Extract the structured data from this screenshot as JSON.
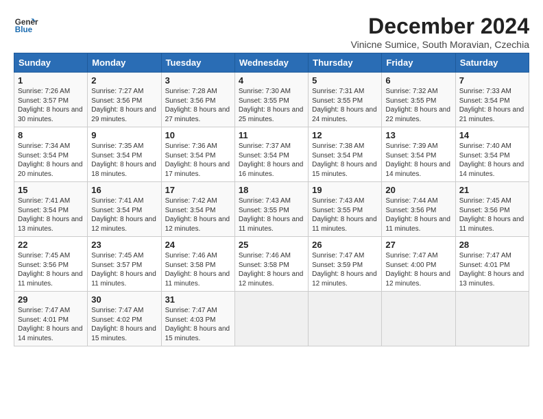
{
  "header": {
    "logo_line1": "General",
    "logo_line2": "Blue",
    "month": "December 2024",
    "location": "Vinicne Sumice, South Moravian, Czechia"
  },
  "weekdays": [
    "Sunday",
    "Monday",
    "Tuesday",
    "Wednesday",
    "Thursday",
    "Friday",
    "Saturday"
  ],
  "weeks": [
    [
      {
        "day": "1",
        "sunrise": "7:26 AM",
        "sunset": "3:57 PM",
        "daylight": "8 hours and 30 minutes."
      },
      {
        "day": "2",
        "sunrise": "7:27 AM",
        "sunset": "3:56 PM",
        "daylight": "8 hours and 29 minutes."
      },
      {
        "day": "3",
        "sunrise": "7:28 AM",
        "sunset": "3:56 PM",
        "daylight": "8 hours and 27 minutes."
      },
      {
        "day": "4",
        "sunrise": "7:30 AM",
        "sunset": "3:55 PM",
        "daylight": "8 hours and 25 minutes."
      },
      {
        "day": "5",
        "sunrise": "7:31 AM",
        "sunset": "3:55 PM",
        "daylight": "8 hours and 24 minutes."
      },
      {
        "day": "6",
        "sunrise": "7:32 AM",
        "sunset": "3:55 PM",
        "daylight": "8 hours and 22 minutes."
      },
      {
        "day": "7",
        "sunrise": "7:33 AM",
        "sunset": "3:54 PM",
        "daylight": "8 hours and 21 minutes."
      }
    ],
    [
      {
        "day": "8",
        "sunrise": "7:34 AM",
        "sunset": "3:54 PM",
        "daylight": "8 hours and 20 minutes."
      },
      {
        "day": "9",
        "sunrise": "7:35 AM",
        "sunset": "3:54 PM",
        "daylight": "8 hours and 18 minutes."
      },
      {
        "day": "10",
        "sunrise": "7:36 AM",
        "sunset": "3:54 PM",
        "daylight": "8 hours and 17 minutes."
      },
      {
        "day": "11",
        "sunrise": "7:37 AM",
        "sunset": "3:54 PM",
        "daylight": "8 hours and 16 minutes."
      },
      {
        "day": "12",
        "sunrise": "7:38 AM",
        "sunset": "3:54 PM",
        "daylight": "8 hours and 15 minutes."
      },
      {
        "day": "13",
        "sunrise": "7:39 AM",
        "sunset": "3:54 PM",
        "daylight": "8 hours and 14 minutes."
      },
      {
        "day": "14",
        "sunrise": "7:40 AM",
        "sunset": "3:54 PM",
        "daylight": "8 hours and 14 minutes."
      }
    ],
    [
      {
        "day": "15",
        "sunrise": "7:41 AM",
        "sunset": "3:54 PM",
        "daylight": "8 hours and 13 minutes."
      },
      {
        "day": "16",
        "sunrise": "7:41 AM",
        "sunset": "3:54 PM",
        "daylight": "8 hours and 12 minutes."
      },
      {
        "day": "17",
        "sunrise": "7:42 AM",
        "sunset": "3:54 PM",
        "daylight": "8 hours and 12 minutes."
      },
      {
        "day": "18",
        "sunrise": "7:43 AM",
        "sunset": "3:55 PM",
        "daylight": "8 hours and 11 minutes."
      },
      {
        "day": "19",
        "sunrise": "7:43 AM",
        "sunset": "3:55 PM",
        "daylight": "8 hours and 11 minutes."
      },
      {
        "day": "20",
        "sunrise": "7:44 AM",
        "sunset": "3:56 PM",
        "daylight": "8 hours and 11 minutes."
      },
      {
        "day": "21",
        "sunrise": "7:45 AM",
        "sunset": "3:56 PM",
        "daylight": "8 hours and 11 minutes."
      }
    ],
    [
      {
        "day": "22",
        "sunrise": "7:45 AM",
        "sunset": "3:56 PM",
        "daylight": "8 hours and 11 minutes."
      },
      {
        "day": "23",
        "sunrise": "7:45 AM",
        "sunset": "3:57 PM",
        "daylight": "8 hours and 11 minutes."
      },
      {
        "day": "24",
        "sunrise": "7:46 AM",
        "sunset": "3:58 PM",
        "daylight": "8 hours and 11 minutes."
      },
      {
        "day": "25",
        "sunrise": "7:46 AM",
        "sunset": "3:58 PM",
        "daylight": "8 hours and 12 minutes."
      },
      {
        "day": "26",
        "sunrise": "7:47 AM",
        "sunset": "3:59 PM",
        "daylight": "8 hours and 12 minutes."
      },
      {
        "day": "27",
        "sunrise": "7:47 AM",
        "sunset": "4:00 PM",
        "daylight": "8 hours and 12 minutes."
      },
      {
        "day": "28",
        "sunrise": "7:47 AM",
        "sunset": "4:01 PM",
        "daylight": "8 hours and 13 minutes."
      }
    ],
    [
      {
        "day": "29",
        "sunrise": "7:47 AM",
        "sunset": "4:01 PM",
        "daylight": "8 hours and 14 minutes."
      },
      {
        "day": "30",
        "sunrise": "7:47 AM",
        "sunset": "4:02 PM",
        "daylight": "8 hours and 15 minutes."
      },
      {
        "day": "31",
        "sunrise": "7:47 AM",
        "sunset": "4:03 PM",
        "daylight": "8 hours and 15 minutes."
      },
      null,
      null,
      null,
      null
    ]
  ]
}
